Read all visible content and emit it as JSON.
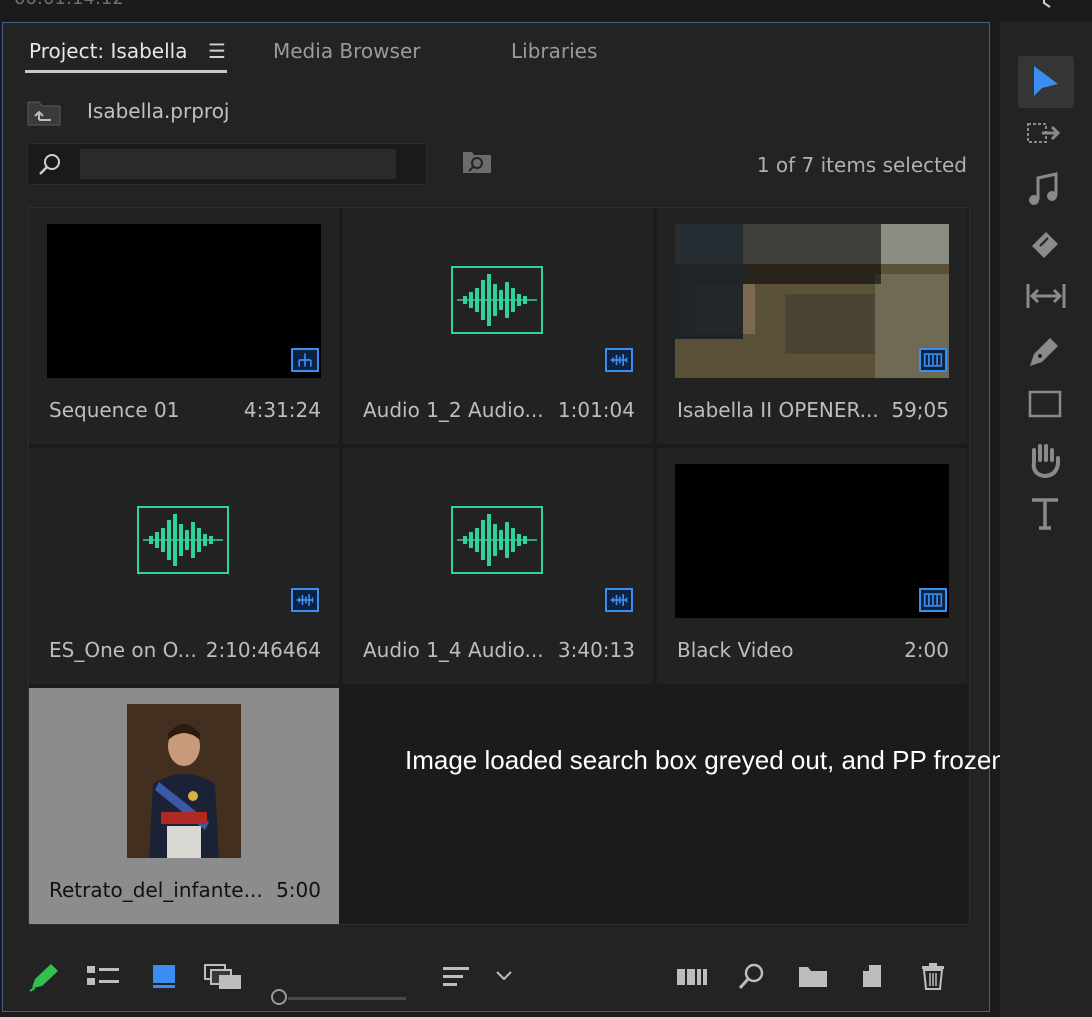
{
  "topbar": {
    "timecode": "00:01:14:12",
    "wrench_icon": "wrench-icon"
  },
  "tabs": [
    {
      "label": "Project: Isabella",
      "active": true
    },
    {
      "label": "Media Browser",
      "active": false
    },
    {
      "label": "Libraries",
      "active": false
    }
  ],
  "menu_icon": "☰",
  "project": {
    "filename": "Isabella.prproj"
  },
  "search": {
    "value": "",
    "placeholder": ""
  },
  "selection_count": "1 of 7 items selected",
  "items": [
    {
      "name": "Sequence 01",
      "duration": "4:31:24",
      "type": "sequence",
      "selected": false
    },
    {
      "name": "Audio 1_2 Audio...",
      "duration": "1:01:04",
      "type": "audio",
      "selected": false
    },
    {
      "name": "Isabella II OPENER...",
      "duration": "59;05",
      "type": "video",
      "selected": false
    },
    {
      "name": "ES_One on O...",
      "duration": "2:10:46464",
      "type": "audio",
      "selected": false
    },
    {
      "name": "Audio 1_4 Audio...",
      "duration": "3:40:13",
      "type": "audio",
      "selected": false
    },
    {
      "name": "Black Video",
      "duration": "2:00",
      "type": "video",
      "selected": false
    },
    {
      "name": "Retrato_del_infante...",
      "duration": "5:00",
      "type": "image",
      "selected": true
    }
  ],
  "annotation": "Image loaded search box greyed out, and PP frozen",
  "colors": {
    "accent": "#3b8ef0",
    "audio_wave": "#2fd39a",
    "selected_bg": "#8c8c8c",
    "pen": "#31c04d"
  },
  "bottom_icons": [
    "pencil-icon",
    "list-view-icon",
    "icon-view-icon",
    "freeform-view-icon",
    "zoom-slider",
    "sort-icon",
    "chevron-down-icon",
    "automate-to-sequence-icon",
    "find-icon",
    "new-bin-icon",
    "new-item-icon",
    "trash-icon"
  ],
  "tools": [
    "selection-tool",
    "track-select-tool",
    "ripple-edit-tool",
    "razor-tool",
    "slip-tool",
    "pen-tool",
    "rectangle-tool",
    "hand-tool",
    "type-tool"
  ]
}
